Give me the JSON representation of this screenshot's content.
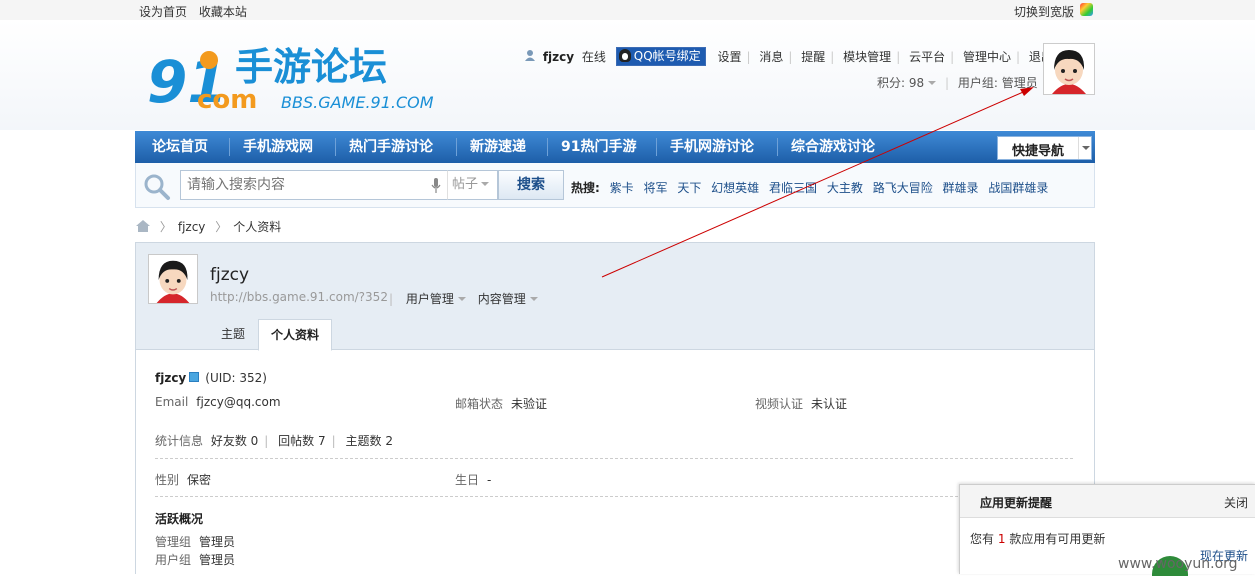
{
  "topbar": {
    "left_links": [
      "设为首页",
      "收藏本站"
    ],
    "right_link": "切换到宽版"
  },
  "logo": {
    "mark": "91",
    "com": "com",
    "title": "手游论坛",
    "url": "BBS.GAME.91.COM"
  },
  "user": {
    "name": "fjzcy",
    "status": "在线",
    "qq_bind": "QQ帐号绑定",
    "links": [
      "设置",
      "消息",
      "提醒",
      "模块管理",
      "云平台",
      "管理中心",
      "退出"
    ],
    "points_label": "积分: 98",
    "group_label": "用户组: 管理员"
  },
  "nav": {
    "items": [
      "论坛首页",
      "手机游戏网",
      "热门手游讨论",
      "新游速递",
      "91热门手游",
      "手机网游讨论",
      "综合游戏讨论"
    ],
    "quick_nav": "快捷导航"
  },
  "search": {
    "placeholder": "请输入搜索内容",
    "type": "帖子",
    "button": "搜索",
    "hot_label": "热搜:",
    "hot_items": [
      "紫卡",
      "将军",
      "天下",
      "幻想英雄",
      "君临三国",
      "大主教",
      "路飞大冒险",
      "群雄录",
      "战国群雄录"
    ]
  },
  "breadcrumb": {
    "user": "fjzcy",
    "page": "个人资料"
  },
  "profile_head": {
    "name": "fjzcy",
    "url": "http://bbs.game.91.com/?352",
    "menus": [
      "用户管理",
      "内容管理"
    ],
    "tabs": [
      "主题",
      "个人资料"
    ]
  },
  "profile": {
    "name": "fjzcy",
    "uid": "(UID: 352)",
    "email_label": "Email",
    "email": "fjzcy@qq.com",
    "mail_status_label": "邮箱状态",
    "mail_status": "未验证",
    "video_label": "视频认证",
    "video_status": "未认证",
    "stats_label": "统计信息",
    "friends": "好友数 0",
    "replies": "回帖数 7",
    "threads": "主题数 2",
    "gender_label": "性别",
    "gender": "保密",
    "birthday_label": "生日",
    "birthday": "-",
    "activity_title": "活跃概况",
    "admin_group_label": "管理组",
    "admin_group": "管理员",
    "user_group_label": "用户组",
    "user_group": "管理员"
  },
  "popup": {
    "title": "应用更新提醒",
    "close": "关闭",
    "message_pre": "您有",
    "count": "1",
    "message_post": "款应用有可用更新",
    "link": "现在更新"
  },
  "watermark": "www.wooyun.org",
  "colors": {
    "nav": "#2a6db8",
    "link": "#1d4f8a",
    "annotation_arrow": "#cc0000"
  }
}
